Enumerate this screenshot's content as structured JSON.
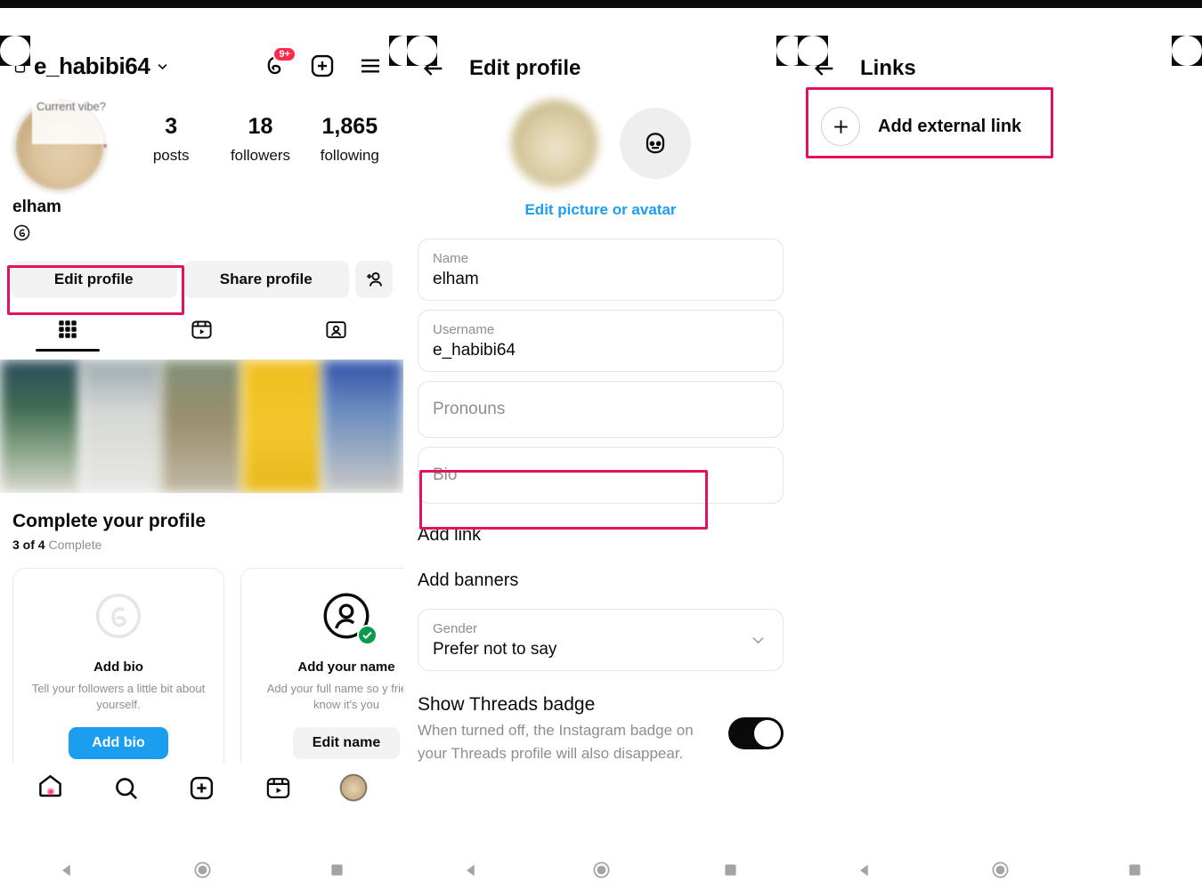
{
  "profile_panel": {
    "header": {
      "username": "e_habibi64",
      "lock_icon": "lock-icon",
      "chevron_icon": "chevron-down-icon",
      "threads_icon": "threads-icon",
      "threads_badge": "9+",
      "create_icon": "plus-square-icon",
      "menu_icon": "hamburger-menu-icon"
    },
    "avatar_note": "Current vibe?",
    "stats": [
      {
        "value": "3",
        "label": "posts"
      },
      {
        "value": "18",
        "label": "followers"
      },
      {
        "value": "1,865",
        "label": "following"
      }
    ],
    "display_name": "elham",
    "threads_chip_icon": "threads-icon",
    "actions": {
      "edit_profile": "Edit profile",
      "share_profile": "Share profile",
      "add_person_icon": "add-person-icon"
    },
    "tabs": [
      {
        "icon": "grid-icon",
        "name": "grid",
        "active": true
      },
      {
        "icon": "reels-icon",
        "name": "reels",
        "active": false
      },
      {
        "icon": "tagged-icon",
        "name": "tagged",
        "active": false
      }
    ],
    "complete": {
      "title": "Complete your profile",
      "progress_bold": "3 of 4",
      "progress_rest": " Complete",
      "cards": [
        {
          "icon": "bio-circle-icon",
          "title": "Add bio",
          "desc": "Tell your followers a little bit about yourself.",
          "button": "Add bio",
          "button_style": "blue"
        },
        {
          "icon": "person-check-icon",
          "title": "Add your name",
          "desc": "Add your full name so y friends know it's you",
          "button": "Edit name",
          "button_style": "grey"
        }
      ]
    },
    "bottom_nav": [
      {
        "icon": "home-icon",
        "name": "home",
        "active": true
      },
      {
        "icon": "search-icon",
        "name": "search",
        "active": false
      },
      {
        "icon": "create-icon",
        "name": "create",
        "active": false
      },
      {
        "icon": "reels-icon",
        "name": "reels",
        "active": false
      },
      {
        "icon": "profile-avatar-icon",
        "name": "profile",
        "active": false
      }
    ]
  },
  "edit_panel": {
    "back_icon": "back-arrow-icon",
    "title": "Edit profile",
    "avatar_alt_icon": "avatar-face-icon",
    "edit_picture_link": "Edit picture or avatar",
    "fields": [
      {
        "label": "Name",
        "value": "elham",
        "placeholder": ""
      },
      {
        "label": "Username",
        "value": "e_habibi64",
        "placeholder": ""
      },
      {
        "label": "",
        "value": "",
        "placeholder": "Pronouns"
      },
      {
        "label": "",
        "value": "",
        "placeholder": "Bio"
      }
    ],
    "add_link_row": "Add link",
    "add_banners_row": "Add banners",
    "gender": {
      "label": "Gender",
      "value": "Prefer not to say",
      "chevron_icon": "chevron-down-icon"
    },
    "threads_badge": {
      "title": "Show Threads badge",
      "desc": "When turned off, the Instagram badge on your Threads profile will also disappear.",
      "toggle_on": true
    }
  },
  "links_panel": {
    "back_icon": "back-arrow-icon",
    "title": "Links",
    "add_external_link": "Add external link",
    "plus_icon": "plus-icon"
  },
  "system_bar": {
    "back_icon": "android-back-icon",
    "home_icon": "android-home-icon",
    "recents_icon": "android-recents-icon"
  },
  "highlights": {
    "accent_color": "#e31260",
    "boxes": [
      "edit-profile-button",
      "bio-field",
      "add-external-link-row"
    ]
  },
  "colors": {
    "blue_link": "#1b9df0",
    "badge_red": "#ff2a4a",
    "check_green": "#0a9b4e",
    "grey_text": "#8e8e8e"
  }
}
